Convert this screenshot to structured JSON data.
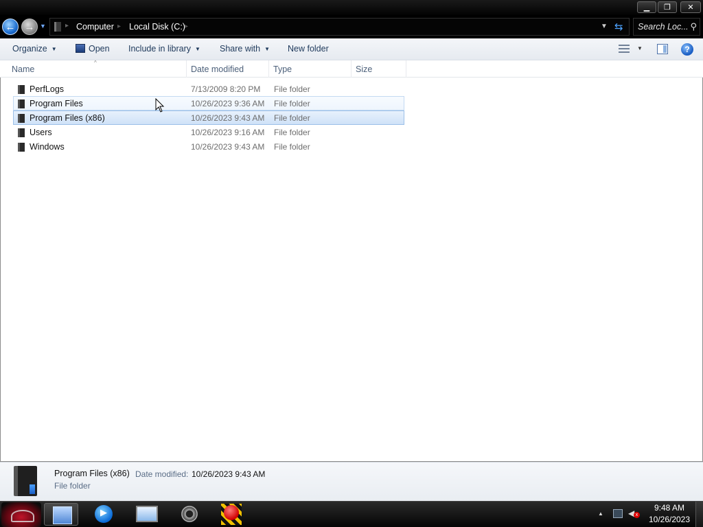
{
  "window": {
    "minimize_glyph": "▁",
    "maximize_glyph": "❐",
    "close_glyph": "✕"
  },
  "address": {
    "crumbs": [
      "Computer",
      "Local Disk (C:)"
    ],
    "separator_glyph": "▸",
    "search_placeholder": "Search Loc...",
    "back_glyph": "←",
    "forward_glyph": "→",
    "dropdown_glyph": "▼",
    "refresh_glyph": "⇆",
    "search_icon_glyph": "⚲"
  },
  "toolbar": {
    "organize": "Organize",
    "open": "Open",
    "include_in_library": "Include in library",
    "share_with": "Share with",
    "new_folder": "New folder",
    "caret_glyph": "▼",
    "help_glyph": "?"
  },
  "columns": {
    "name": "Name",
    "date_modified": "Date modified",
    "type": "Type",
    "size": "Size",
    "sort_glyph": "^"
  },
  "files": [
    {
      "name": "PerfLogs",
      "date": "7/13/2009 8:20 PM",
      "type": "File folder",
      "state": "normal"
    },
    {
      "name": "Program Files",
      "date": "10/26/2023 9:36 AM",
      "type": "File folder",
      "state": "hover"
    },
    {
      "name": "Program Files (x86)",
      "date": "10/26/2023 9:43 AM",
      "type": "File folder",
      "state": "selected"
    },
    {
      "name": "Users",
      "date": "10/26/2023 9:16 AM",
      "type": "File folder",
      "state": "normal"
    },
    {
      "name": "Windows",
      "date": "10/26/2023 9:43 AM",
      "type": "File folder",
      "state": "normal"
    }
  ],
  "details": {
    "name": "Program Files (x86)",
    "date_label": "Date modified:",
    "date": "10/26/2023 9:43 AM",
    "type": "File folder"
  },
  "taskbar": {
    "items": [
      "start-orb",
      "windows-explorer",
      "media-player",
      "network-connections",
      "camera-app",
      "screen-recorder"
    ],
    "play_glyph": "▶",
    "tray_arrow_glyph": "▲",
    "volume_glyph": "◀",
    "muted_glyph": "x",
    "time": "9:48 AM",
    "date": "10/26/2023"
  },
  "colors": {
    "selection_fill": "#cfe2f8",
    "selection_border": "#9cc0e8",
    "hover_fill": "#eef5fd",
    "toolbar_text": "#1e395b",
    "header_text": "#4c607a"
  }
}
